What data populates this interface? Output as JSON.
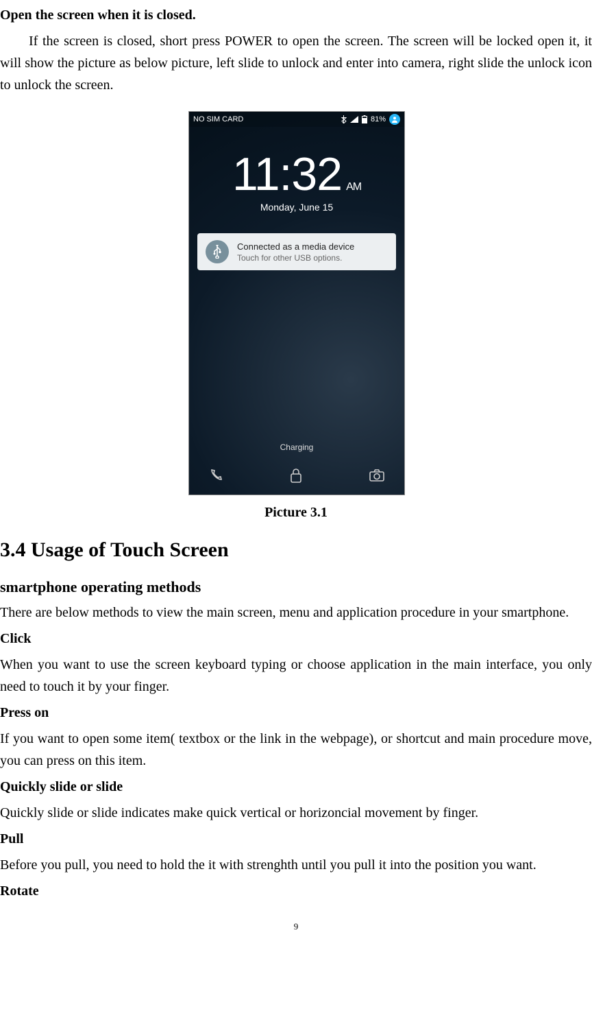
{
  "heading_open": "Open the screen when it is closed.",
  "para_open": "If the screen is closed, short press POWER to open the screen. The screen will be locked open it, it will show the picture as below picture, left slide to unlock and enter into camera, right slide the unlock icon to unlock the screen.",
  "phone": {
    "status": {
      "carrier": "NO SIM CARD",
      "battery": "81%"
    },
    "clock": {
      "time": "11:32",
      "ampm": "AM",
      "date": "Monday, June 15"
    },
    "notif": {
      "title": "Connected as a media device",
      "sub": "Touch for other USB options."
    },
    "charging": "Charging"
  },
  "caption": "Picture 3.1",
  "section_title": "3.4 Usage of Touch Screen",
  "subsection_title": "smartphone operating methods",
  "para_methods_intro": "There are below methods to view the main screen, menu and application procedure in your smartphone.",
  "click_h": "Click",
  "click_p": "When you want to use the screen keyboard typing or choose application in the main interface, you only need to touch it by your finger.",
  "press_h": "Press on",
  "press_p": "If you want to open some item( textbox or the link in the webpage), or shortcut and main procedure move, you can press on this item.",
  "slide_h": "Quickly slide or slide",
  "slide_p": "Quickly slide or slide indicates make quick vertical or horizoncial movement by finger.",
  "pull_h": "Pull",
  "pull_p": "Before you pull, you need to hold the it with strenghth until you pull it into the position you want.",
  "rotate_h": "Rotate",
  "page_number": "9"
}
